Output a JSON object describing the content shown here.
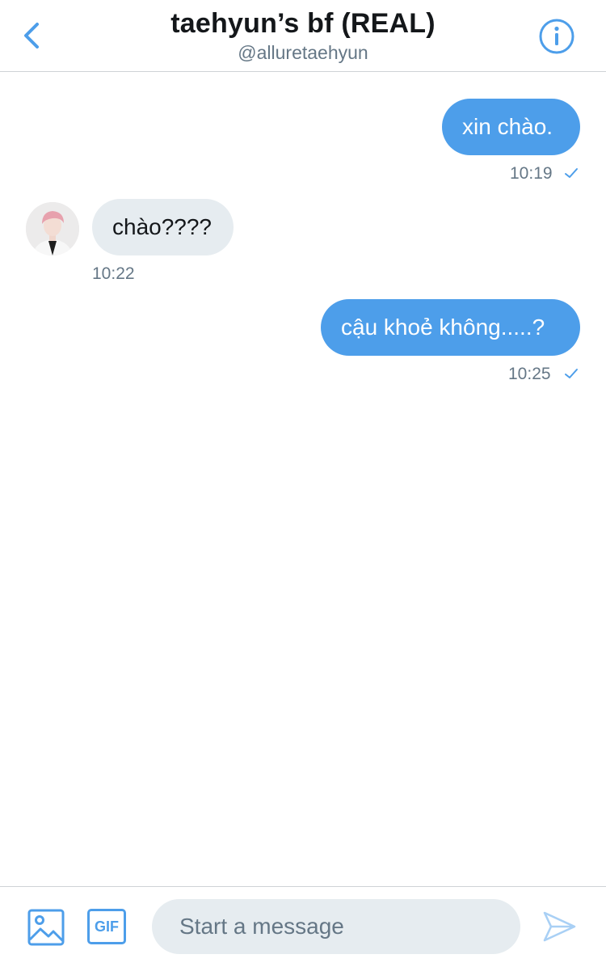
{
  "header": {
    "title": "taehyun’s bf (REAL)",
    "handle": "@alluretaehyun"
  },
  "messages": [
    {
      "direction": "outgoing",
      "text": "xin chào.",
      "time": "10:19",
      "status": "sent-check"
    },
    {
      "direction": "incoming",
      "text": "chào????",
      "time": "10:22"
    },
    {
      "direction": "outgoing",
      "text": "cậu khoẻ không.....?",
      "time": "10:25",
      "status": "sent-check"
    }
  ],
  "composer": {
    "gif_label": "GIF",
    "placeholder": "Start a message",
    "value": ""
  },
  "icons": {
    "back": "chevron-left-icon",
    "info": "info-icon",
    "media": "image-icon",
    "send": "send-icon",
    "read": "check-icon"
  },
  "colors": {
    "accent": "#4d9eea",
    "incoming_bubble": "#e6ecf0",
    "muted_text": "#657786"
  }
}
